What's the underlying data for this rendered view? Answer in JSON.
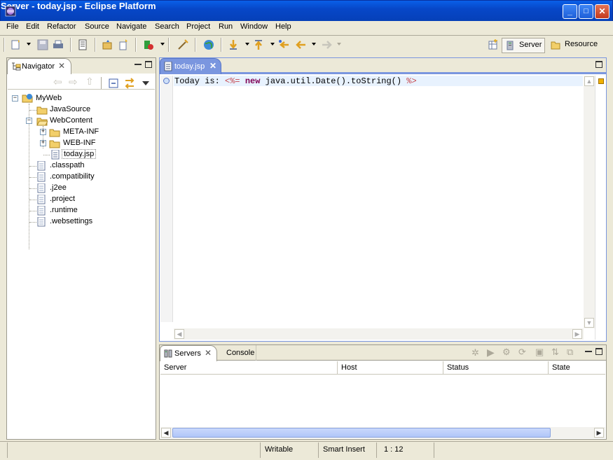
{
  "window": {
    "title": "Server - today.jsp - Eclipse Platform",
    "minimize": "_",
    "maximize": "□",
    "close": "✕"
  },
  "menubar": {
    "items": [
      "File",
      "Edit",
      "Refactor",
      "Source",
      "Navigate",
      "Search",
      "Project",
      "Run",
      "Window",
      "Help"
    ]
  },
  "perspectives": {
    "open_icon": "open-perspective-icon",
    "items": [
      {
        "label": "Server",
        "active": true,
        "icon": "server-perspective-icon"
      },
      {
        "label": "Resource",
        "active": false,
        "icon": "resource-perspective-icon"
      }
    ]
  },
  "navigator": {
    "tab_label": "Navigator",
    "tree": {
      "project": "MyWeb",
      "items": [
        {
          "label": "JavaSource",
          "type": "folder"
        },
        {
          "label": "WebContent",
          "type": "folder",
          "expanded": true,
          "children": [
            {
              "label": "META-INF",
              "type": "folder"
            },
            {
              "label": "WEB-INF",
              "type": "folder"
            },
            {
              "label": "today.jsp",
              "type": "file",
              "selected": true
            }
          ]
        },
        {
          "label": ".classpath",
          "type": "file"
        },
        {
          "label": ".compatibility",
          "type": "file"
        },
        {
          "label": ".j2ee",
          "type": "file"
        },
        {
          "label": ".project",
          "type": "file"
        },
        {
          "label": ".runtime",
          "type": "file"
        },
        {
          "label": ".websettings",
          "type": "file"
        }
      ]
    }
  },
  "editor": {
    "tab_label": "today.jsp",
    "line1": {
      "text": "Today is: ",
      "open_tag": "<%=",
      "keyword": "new",
      "expr": "java.util.Date().toString()",
      "close_tag": "%>"
    }
  },
  "bottom": {
    "tabs": [
      "Servers",
      "Console"
    ],
    "columns": [
      "Server",
      "Host",
      "Status",
      "State"
    ]
  },
  "status": {
    "mode": "Writable",
    "insert": "Smart Insert",
    "position": "1 : 12"
  },
  "colors": {
    "title_bar": "#0747c8",
    "jsp_tag": "#c7474e",
    "keyword": "#7f0055",
    "active_view_border": "#7a96df",
    "selection": "#ffffff"
  }
}
